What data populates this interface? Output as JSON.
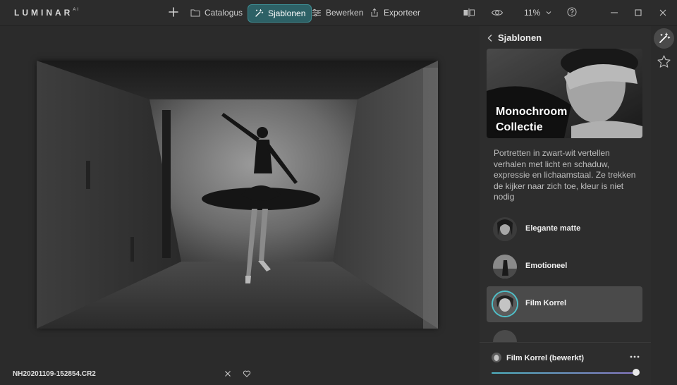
{
  "app": {
    "logo": "LUMINAR",
    "logo_suffix": "AI"
  },
  "nav": {
    "catalogue": "Catalogus",
    "templates": "Sjablonen",
    "edit": "Bewerken",
    "export": "Exporteer"
  },
  "toolbar": {
    "zoom": "11%"
  },
  "status": {
    "filename": "NH20201109-152854.CR2"
  },
  "panel": {
    "title": "Sjablonen",
    "hero_title_line1": "Monochroom",
    "hero_title_line2": "Collectie",
    "description": "Portretten in zwart-wit vertellen verhalen met licht en schaduw, expressie en lichaamstaal. Ze trekken de kijker naar zich toe, kleur is niet nodig",
    "presets": [
      {
        "label": "Elegante matte"
      },
      {
        "label": "Emotioneel"
      },
      {
        "label": "Film Korrel"
      }
    ],
    "applied": "Film Korrel (bewerkt)",
    "amount": 1.0
  },
  "colors": {
    "accent": "#2d6166",
    "accent_border": "#3c8b91",
    "selected_ring": "#4fc0c9"
  },
  "icons": {
    "plus": "plus-icon",
    "catalogue": "folder-icon",
    "templates": "magic-wand-icon",
    "edit": "sliders-icon",
    "export": "export-icon",
    "compare": "compare-icon",
    "eye": "eye-icon",
    "help": "help-icon",
    "back": "chevron-left-icon",
    "favorite": "heart-icon",
    "reject": "close-icon",
    "star": "star-icon"
  }
}
